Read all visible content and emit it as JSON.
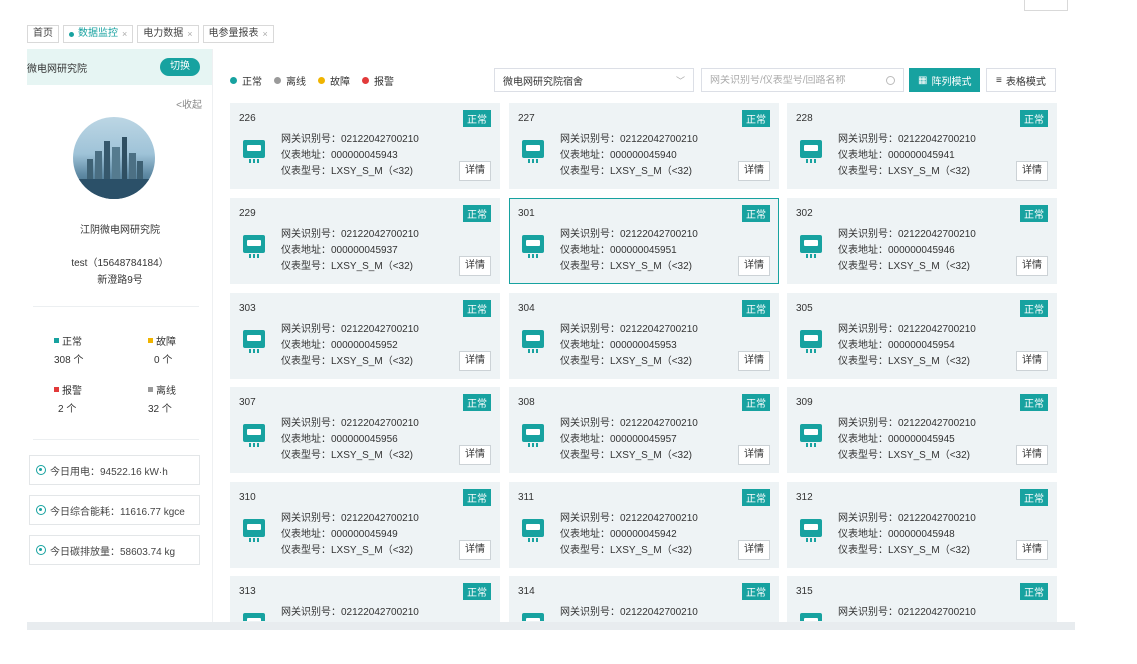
{
  "tabs": [
    {
      "label": "首页",
      "active": false,
      "closable": false
    },
    {
      "label": "数据监控",
      "active": true,
      "closable": true
    },
    {
      "label": "电力数据",
      "active": false,
      "closable": true
    },
    {
      "label": "电参量报表",
      "active": false,
      "closable": true
    }
  ],
  "sidebar": {
    "org_title": "微电网研究院",
    "switch_label": "切换",
    "collapse_label": "<收起",
    "org_name": "江阴微电网研究院",
    "user": "test（15648784184）",
    "address": "新澄路9号",
    "stats": [
      {
        "label": "正常",
        "value": "308 个",
        "color": "#17a2a0"
      },
      {
        "label": "故障",
        "value": "0 个",
        "color": "#f0b400"
      },
      {
        "label": "报警",
        "value": "2 个",
        "color": "#e23a3a"
      },
      {
        "label": "离线",
        "value": "32 个",
        "color": "#9a9a9a"
      }
    ],
    "energy": [
      {
        "label": "今日用电：94522.16 kW·h"
      },
      {
        "label": "今日综合能耗：11616.77 kgce"
      },
      {
        "label": "今日碳排放量：58603.74 kg"
      }
    ]
  },
  "legend": [
    {
      "label": "正常",
      "color": "#17a2a0"
    },
    {
      "label": "离线",
      "color": "#9a9a9a"
    },
    {
      "label": "故障",
      "color": "#f0b400"
    },
    {
      "label": "报警",
      "color": "#e23a3a"
    }
  ],
  "toolbar": {
    "select_value": "微电网研究院宿舍",
    "search_placeholder": "网关识别号/仪表型号/回路名称",
    "grid_mode": "阵列模式",
    "table_mode": "表格模式"
  },
  "card_labels": {
    "gateway": "网关识别号：",
    "address": "仪表地址：",
    "model": "仪表型号：",
    "detail": "详情"
  },
  "cards": [
    {
      "id": "226",
      "status": "正常",
      "gateway": "02122042700210",
      "address": "000000045943",
      "model": "LXSY_S_M（<32)",
      "active": false
    },
    {
      "id": "227",
      "status": "正常",
      "gateway": "02122042700210",
      "address": "000000045940",
      "model": "LXSY_S_M（<32)",
      "active": false
    },
    {
      "id": "228",
      "status": "正常",
      "gateway": "02122042700210",
      "address": "000000045941",
      "model": "LXSY_S_M（<32)",
      "active": false
    },
    {
      "id": "229",
      "status": "正常",
      "gateway": "02122042700210",
      "address": "000000045937",
      "model": "LXSY_S_M（<32)",
      "active": false
    },
    {
      "id": "301",
      "status": "正常",
      "gateway": "02122042700210",
      "address": "000000045951",
      "model": "LXSY_S_M（<32)",
      "active": true
    },
    {
      "id": "302",
      "status": "正常",
      "gateway": "02122042700210",
      "address": "000000045946",
      "model": "LXSY_S_M（<32)",
      "active": false
    },
    {
      "id": "303",
      "status": "正常",
      "gateway": "02122042700210",
      "address": "000000045952",
      "model": "LXSY_S_M（<32)",
      "active": false
    },
    {
      "id": "304",
      "status": "正常",
      "gateway": "02122042700210",
      "address": "000000045953",
      "model": "LXSY_S_M（<32)",
      "active": false
    },
    {
      "id": "305",
      "status": "正常",
      "gateway": "02122042700210",
      "address": "000000045954",
      "model": "LXSY_S_M（<32)",
      "active": false
    },
    {
      "id": "307",
      "status": "正常",
      "gateway": "02122042700210",
      "address": "000000045956",
      "model": "LXSY_S_M（<32)",
      "active": false
    },
    {
      "id": "308",
      "status": "正常",
      "gateway": "02122042700210",
      "address": "000000045957",
      "model": "LXSY_S_M（<32)",
      "active": false
    },
    {
      "id": "309",
      "status": "正常",
      "gateway": "02122042700210",
      "address": "000000045945",
      "model": "LXSY_S_M（<32)",
      "active": false
    },
    {
      "id": "310",
      "status": "正常",
      "gateway": "02122042700210",
      "address": "000000045949",
      "model": "LXSY_S_M（<32)",
      "active": false
    },
    {
      "id": "311",
      "status": "正常",
      "gateway": "02122042700210",
      "address": "000000045942",
      "model": "LXSY_S_M（<32)",
      "active": false
    },
    {
      "id": "312",
      "status": "正常",
      "gateway": "02122042700210",
      "address": "000000045948",
      "model": "LXSY_S_M（<32)",
      "active": false
    },
    {
      "id": "313",
      "status": "正常",
      "gateway": "02122042700210",
      "active": false
    },
    {
      "id": "314",
      "status": "正常",
      "gateway": "02122042700210",
      "active": false
    },
    {
      "id": "315",
      "status": "正常",
      "gateway": "02122042700210",
      "active": false
    }
  ]
}
